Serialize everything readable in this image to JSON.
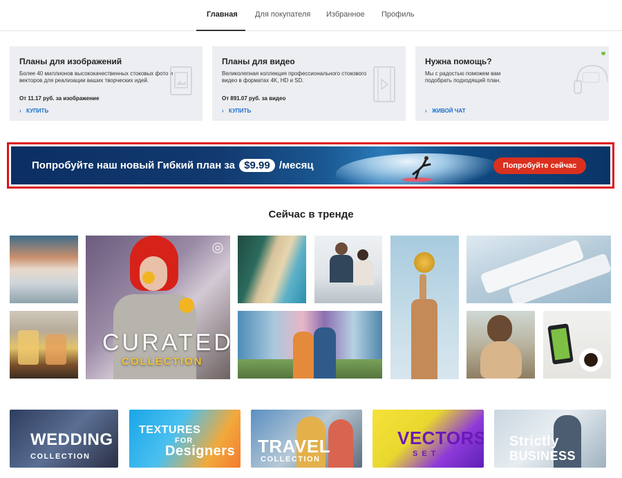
{
  "nav": {
    "tabs": [
      {
        "label": "Главная",
        "active": true
      },
      {
        "label": "Для покупателя",
        "active": false
      },
      {
        "label": "Избранное",
        "active": false
      },
      {
        "label": "Профиль",
        "active": false
      }
    ]
  },
  "cards": [
    {
      "title": "Планы для изображений",
      "description": "Более 40 миллионов высококачественных стоковых фото и векторов для реализации ваших творческих идей.",
      "price": "От 11.17 руб. за изображение",
      "action": "КУПИТЬ",
      "icon": "image-frame-icon"
    },
    {
      "title": "Планы для видео",
      "description": "Великолепная коллекция профессионального стокового видео в форматах 4K, HD и SD.",
      "price": "От 891.07 руб. за видео",
      "action": "КУПИТЬ",
      "icon": "film-strip-icon"
    },
    {
      "title": "Нужна помощь?",
      "description": "Мы с радостью поможем вам подобрать подходящий план.",
      "price": "",
      "action": "ЖИВОЙ ЧАТ",
      "icon": "headset-icon",
      "status_color": "#7cc04b"
    }
  ],
  "banner": {
    "text_before": "Попробуйте наш новый Гибкий план за",
    "price": "$9.99",
    "text_after": "/месяц",
    "cta": "Попробуйте сейчас",
    "highlight_color": "#e0101b",
    "cta_color": "#d9301f"
  },
  "trending": {
    "title": "Сейчас в тренде",
    "curated_big": "CURATED",
    "curated_small": "COLLECTION",
    "tiles": [
      "mountain-clouds-photo",
      "cocktails-photo",
      "curated-woman-oranges-photo",
      "beach-aerial-photo",
      "office-workers-photo",
      "friends-smoke-photo",
      "bitcoin-hand-photo",
      "cosmetics-tubes-photo",
      "woman-dog-photo",
      "phone-coffee-photo"
    ]
  },
  "collections": [
    {
      "big": "WEDDING",
      "small": "COLLECTION"
    },
    {
      "big": "TEXTURES",
      "mid": "FOR",
      "big2": "Designers"
    },
    {
      "big": "TRAVEL",
      "small": "COLLECTION"
    },
    {
      "big": "VECTORS",
      "small": "SET"
    },
    {
      "big": "Strictly",
      "big2": "BUSINESS"
    }
  ]
}
